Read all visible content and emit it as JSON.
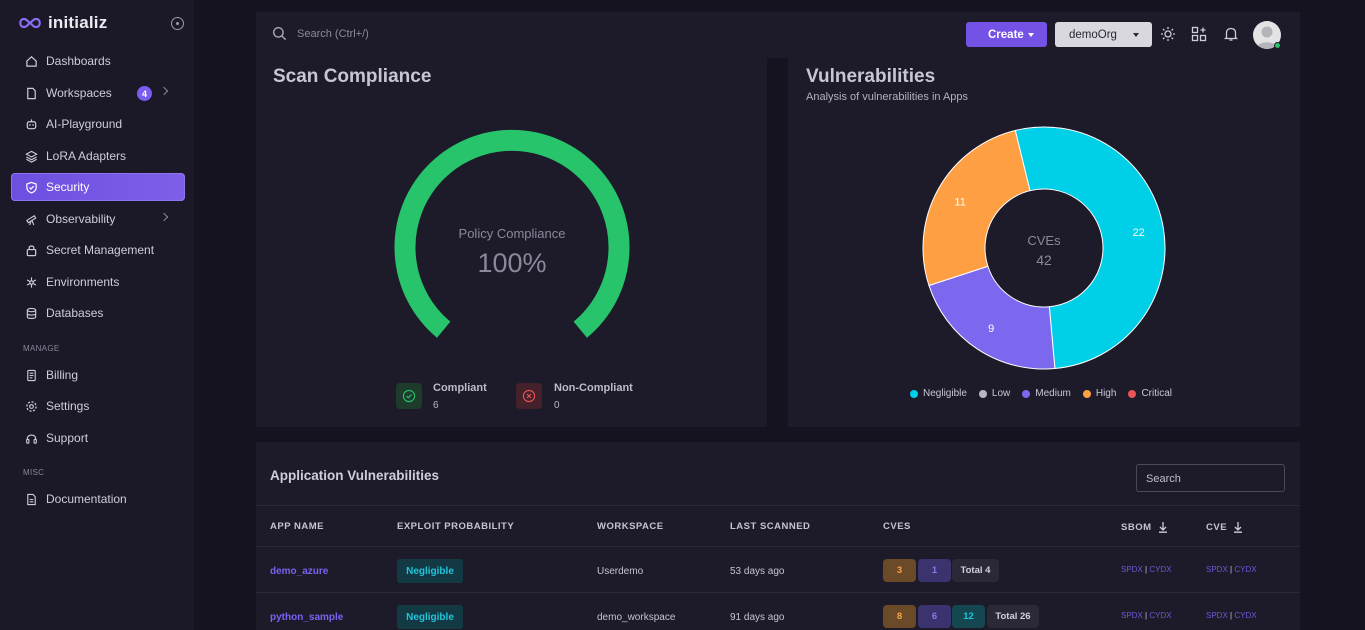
{
  "brand": {
    "name": "initializ"
  },
  "sidebar": {
    "items": [
      {
        "label": "Dashboards",
        "icon": "home-icon"
      },
      {
        "label": "Workspaces",
        "icon": "file-icon",
        "badge": "4"
      },
      {
        "label": "AI-Playground",
        "icon": "robot-icon"
      },
      {
        "label": "LoRA Adapters",
        "icon": "layers-icon"
      },
      {
        "label": "Security",
        "icon": "shield-icon",
        "active": true
      },
      {
        "label": "Observability",
        "icon": "telescope-icon"
      },
      {
        "label": "Secret Management",
        "icon": "lock-icon"
      },
      {
        "label": "Environments",
        "icon": "snowflake-icon"
      },
      {
        "label": "Databases",
        "icon": "database-icon"
      }
    ],
    "manage_label": "MANAGE",
    "manage_items": [
      {
        "label": "Billing",
        "icon": "receipt-icon"
      },
      {
        "label": "Settings",
        "icon": "gear-icon"
      },
      {
        "label": "Support",
        "icon": "headset-icon"
      }
    ],
    "misc_label": "MISC",
    "misc_items": [
      {
        "label": "Documentation",
        "icon": "document-icon"
      }
    ]
  },
  "topbar": {
    "search_placeholder": "Search (Ctrl+/)",
    "create_label": "Create",
    "org_label": "demoOrg"
  },
  "scan_compliance": {
    "title": "Scan Compliance",
    "gauge_label": "Policy Compliance",
    "gauge_value": "100%",
    "compliant_label": "Compliant",
    "compliant_count": "6",
    "noncompliant_label": "Non-Compliant",
    "noncompliant_count": "0"
  },
  "vulnerabilities": {
    "title": "Vulnerabilities",
    "subtitle": "Analysis of vulnerabilities in Apps",
    "center_label": "CVEs",
    "center_value": "42"
  },
  "chart_data": {
    "type": "pie",
    "donut": true,
    "series": [
      {
        "name": "Negligible",
        "value": 22,
        "color": "#00cfe8"
      },
      {
        "name": "Low",
        "value": 0,
        "color": "#b9b7c4"
      },
      {
        "name": "Medium",
        "value": 9,
        "color": "#7b68ee"
      },
      {
        "name": "High",
        "value": 11,
        "color": "#ff9f43"
      },
      {
        "name": "Critical",
        "value": 0,
        "color": "#ea5455"
      }
    ],
    "legend_position": "bottom"
  },
  "table": {
    "title": "Application Vulnerabilities",
    "search_placeholder": "Search",
    "headers": [
      "APP NAME",
      "EXPLOIT PROBABILITY",
      "WORKSPACE",
      "LAST SCANNED",
      "CVES",
      "SBOM",
      "CVE"
    ],
    "sbom_links": [
      "SPDX",
      "CYDX"
    ],
    "rows": [
      {
        "app": "demo_azure",
        "exploit": "Negligible",
        "workspace": "Userdemo",
        "scanned": "53 days ago",
        "cves": {
          "orange": "3",
          "purple": "1",
          "total": "Total 4"
        }
      },
      {
        "app": "python_sample",
        "exploit": "Negligible",
        "workspace": "demo_workspace",
        "scanned": "91 days ago",
        "cves": {
          "orange": "8",
          "purple": "6",
          "cyan": "12",
          "total": "Total 26"
        }
      }
    ]
  },
  "colors": {
    "accent": "#7552e6",
    "success": "#26c467",
    "danger": "#ea5455"
  }
}
